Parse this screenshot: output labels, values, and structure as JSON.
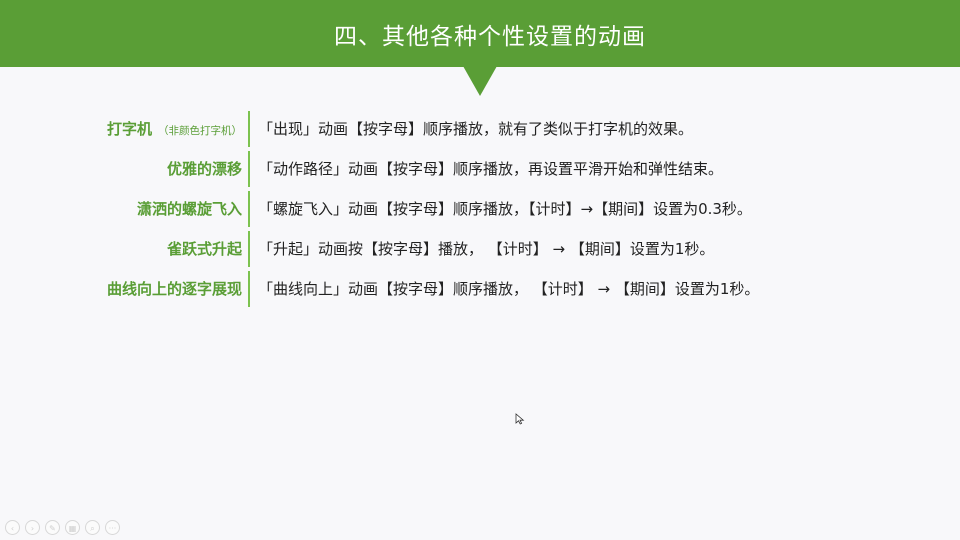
{
  "slide": {
    "title": "四、其他各种个性设置的动画",
    "accent_color": "#5a9e36"
  },
  "rows": [
    {
      "label": "打字机",
      "sublabel": "（非颜色打字机）",
      "description": "「出现」动画【按字母】顺序播放，就有了类似于打字机的效果。"
    },
    {
      "label": "优雅的漂移",
      "sublabel": "",
      "description": "「动作路径」动画【按字母】顺序播放，再设置平滑开始和弹性结束。"
    },
    {
      "label": "潇洒的螺旋飞入",
      "sublabel": "",
      "description": "「螺旋飞入」动画【按字母】顺序播放，【计时】→【期间】设置为0.3秒。"
    },
    {
      "label": "雀跃式升起",
      "sublabel": "",
      "description": "「升起」动画按【按字母】播放， 【计时】 → 【期间】设置为1秒。"
    },
    {
      "label": "曲线向上的逐字展现",
      "sublabel": "",
      "description": "「曲线向上」动画【按字母】顺序播放， 【计时】 → 【期间】设置为1秒。"
    }
  ],
  "nav_controls": [
    {
      "name": "previous-slide-icon",
      "glyph": "‹"
    },
    {
      "name": "next-slide-icon",
      "glyph": "›"
    },
    {
      "name": "pen-icon",
      "glyph": "✎"
    },
    {
      "name": "slides-grid-icon",
      "glyph": "▦"
    },
    {
      "name": "zoom-icon",
      "glyph": "⌕"
    },
    {
      "name": "more-options-icon",
      "glyph": "···"
    }
  ]
}
